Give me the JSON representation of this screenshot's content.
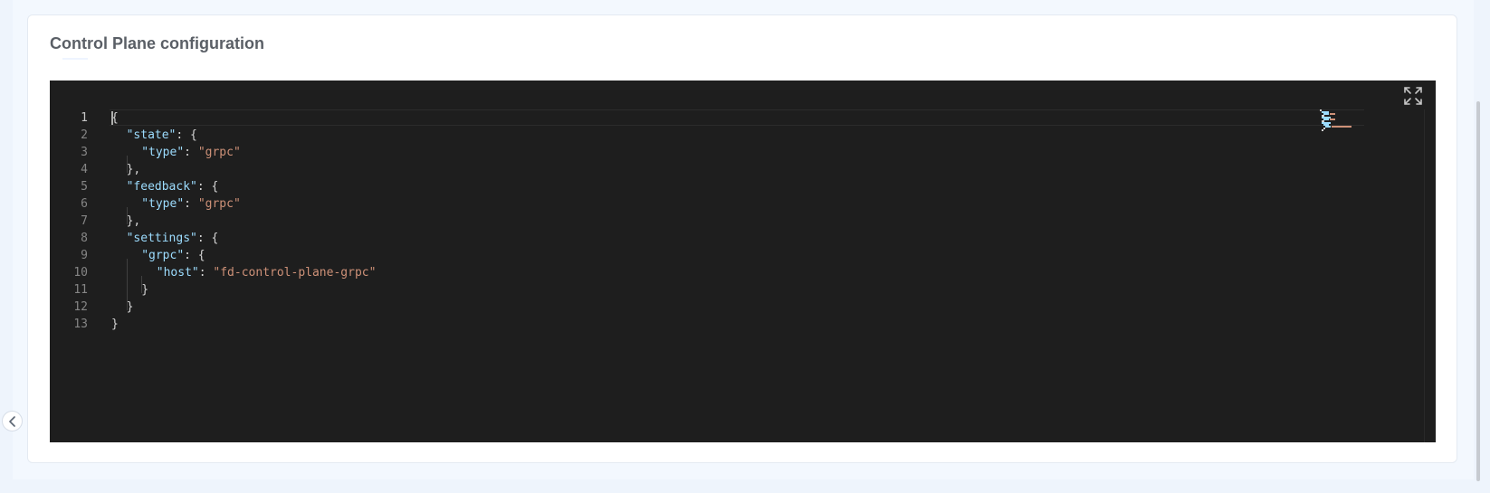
{
  "card": {
    "title": "Control Plane configuration"
  },
  "editor": {
    "language": "json",
    "active_line": 1,
    "colors": {
      "background": "#1e1e1e",
      "key": "#9cdcfe",
      "string": "#ce9178",
      "punctuation": "#d4d4d4",
      "line_number": "#858585"
    },
    "line_numbers": [
      "1",
      "2",
      "3",
      "4",
      "5",
      "6",
      "7",
      "8",
      "9",
      "10",
      "11",
      "12",
      "13"
    ],
    "lines": [
      {
        "indent": 0,
        "tokens": [
          {
            "t": "p",
            "v": "{"
          }
        ]
      },
      {
        "indent": 1,
        "tokens": [
          {
            "t": "k",
            "v": "\"state\""
          },
          {
            "t": "p",
            "v": ": {"
          }
        ]
      },
      {
        "indent": 2,
        "tokens": [
          {
            "t": "k",
            "v": "\"type\""
          },
          {
            "t": "p",
            "v": ": "
          },
          {
            "t": "s",
            "v": "\"grpc\""
          }
        ]
      },
      {
        "indent": 1,
        "tokens": [
          {
            "t": "p",
            "v": "},"
          }
        ]
      },
      {
        "indent": 1,
        "tokens": [
          {
            "t": "k",
            "v": "\"feedback\""
          },
          {
            "t": "p",
            "v": ": {"
          }
        ]
      },
      {
        "indent": 2,
        "tokens": [
          {
            "t": "k",
            "v": "\"type\""
          },
          {
            "t": "p",
            "v": ": "
          },
          {
            "t": "s",
            "v": "\"grpc\""
          }
        ]
      },
      {
        "indent": 1,
        "tokens": [
          {
            "t": "p",
            "v": "},"
          }
        ]
      },
      {
        "indent": 1,
        "tokens": [
          {
            "t": "k",
            "v": "\"settings\""
          },
          {
            "t": "p",
            "v": ": {"
          }
        ]
      },
      {
        "indent": 2,
        "tokens": [
          {
            "t": "k",
            "v": "\"grpc\""
          },
          {
            "t": "p",
            "v": ": {"
          }
        ]
      },
      {
        "indent": 3,
        "tokens": [
          {
            "t": "k",
            "v": "\"host\""
          },
          {
            "t": "p",
            "v": ": "
          },
          {
            "t": "s",
            "v": "\"fd-control-plane-grpc\""
          }
        ]
      },
      {
        "indent": 2,
        "tokens": [
          {
            "t": "p",
            "v": "}"
          }
        ]
      },
      {
        "indent": 1,
        "tokens": [
          {
            "t": "p",
            "v": "}"
          }
        ]
      },
      {
        "indent": 0,
        "tokens": [
          {
            "t": "p",
            "v": "}"
          }
        ]
      }
    ],
    "expand_icon": "expand-icon"
  },
  "sidebar_toggle": {
    "icon": "chevron-left-icon"
  }
}
